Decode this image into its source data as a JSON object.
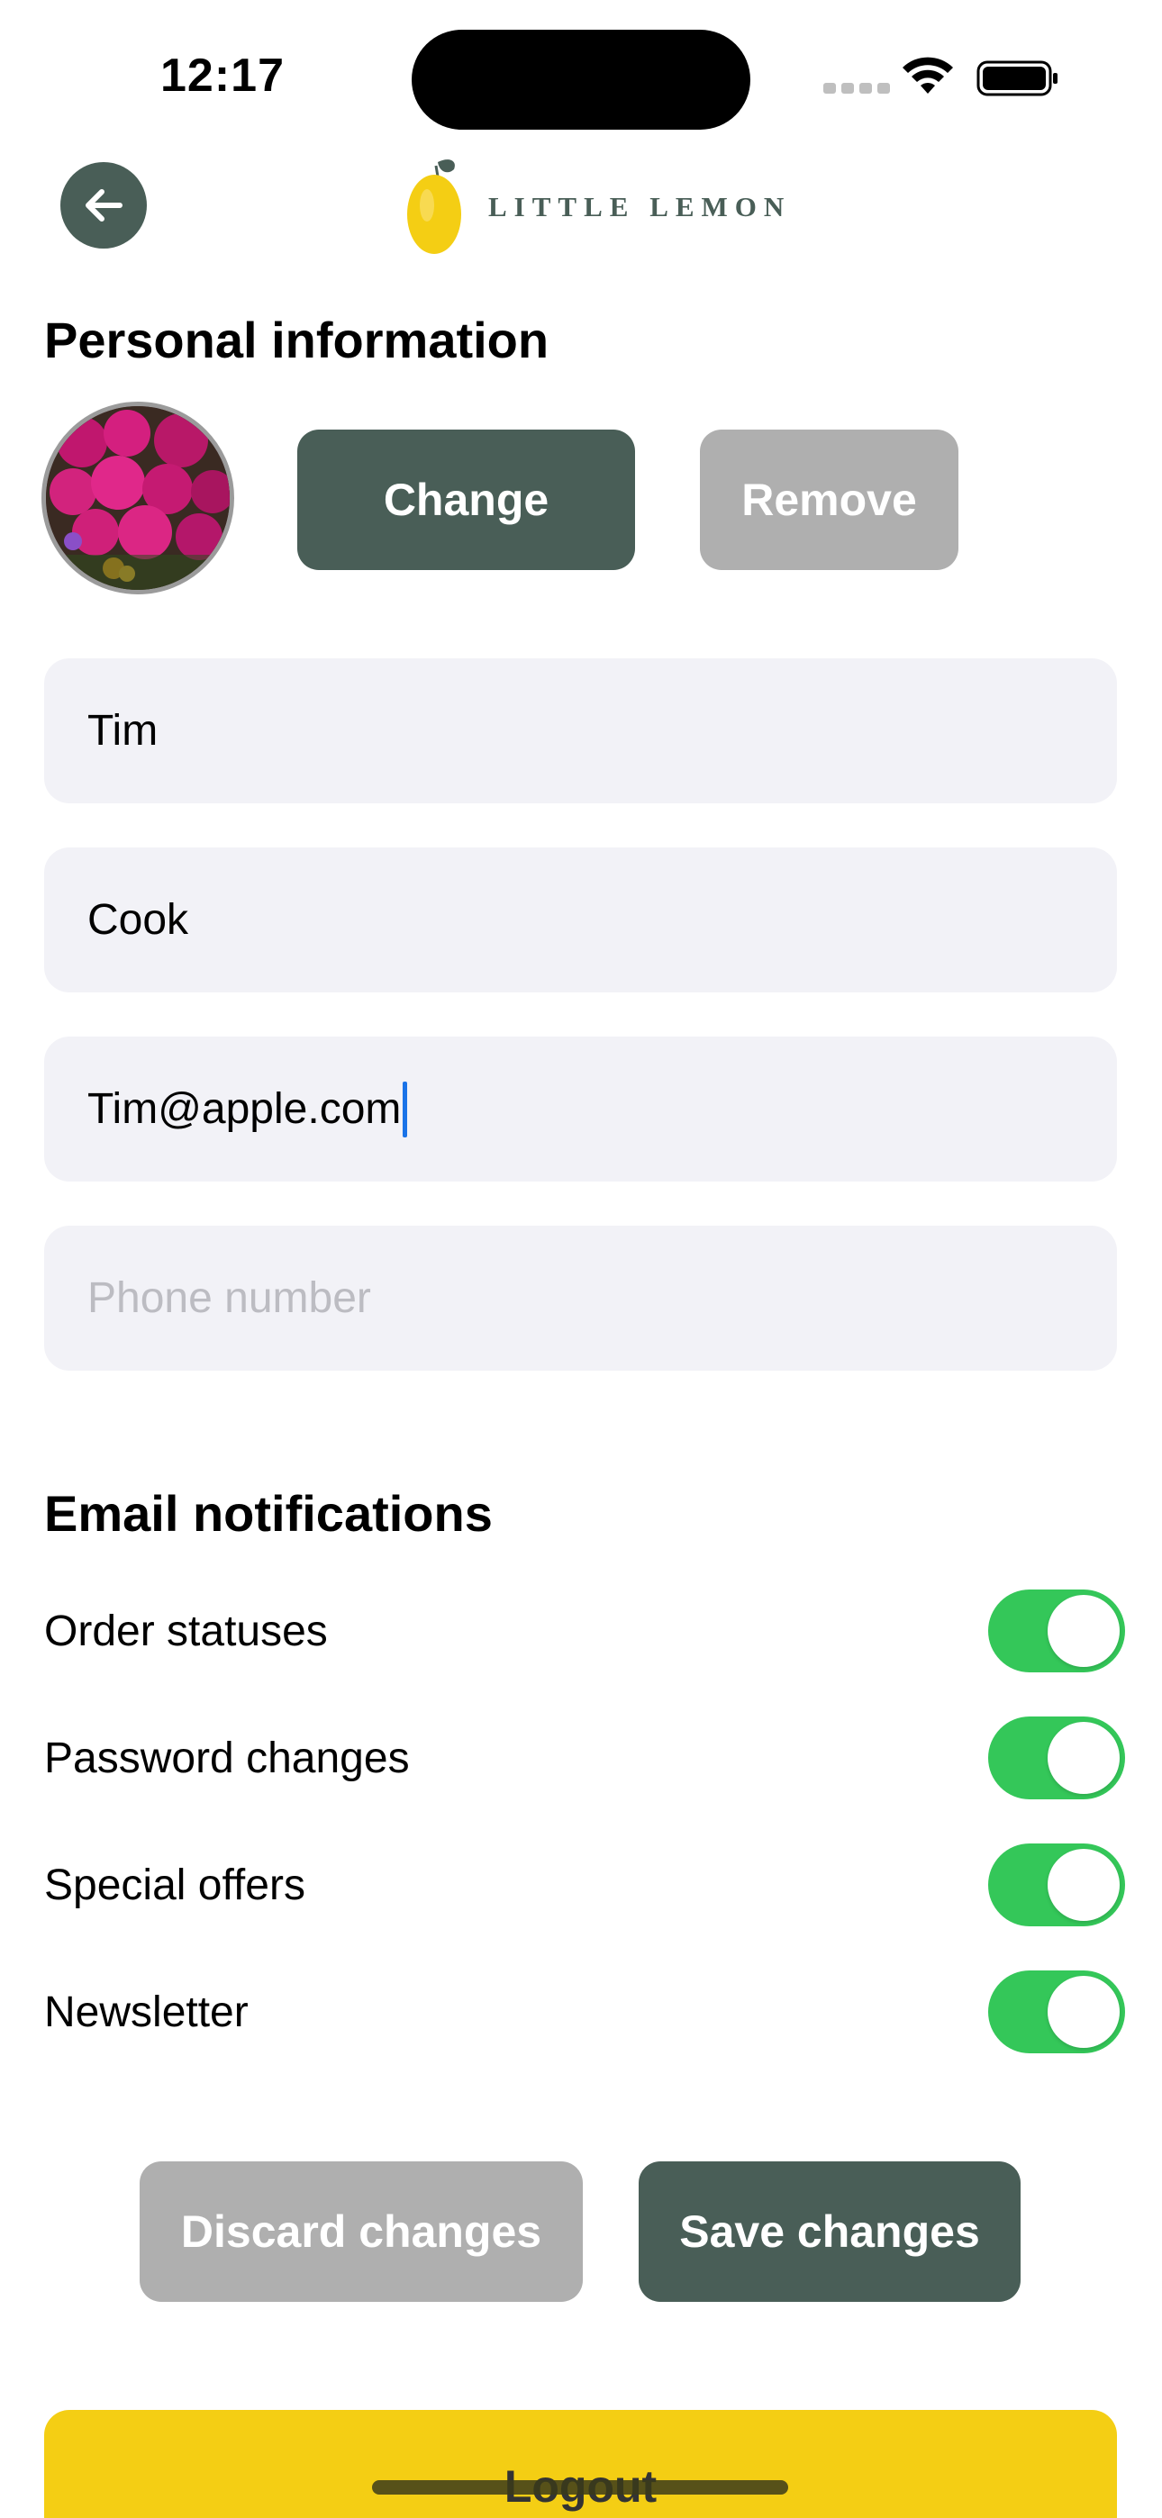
{
  "status_bar": {
    "time": "12:17"
  },
  "header": {
    "logo_text": "LITTLE LEMON",
    "back_icon": "arrow-left-icon"
  },
  "personal_info": {
    "title": "Personal information",
    "change_label": "Change",
    "remove_label": "Remove"
  },
  "form": {
    "first_name": "Tim",
    "last_name": "Cook",
    "email": "Tim@apple.com",
    "phone_placeholder": "Phone number"
  },
  "notifications": {
    "title": "Email notifications",
    "items": [
      {
        "label": "Order statuses",
        "enabled": true
      },
      {
        "label": "Password changes",
        "enabled": true
      },
      {
        "label": "Special offers",
        "enabled": true
      },
      {
        "label": "Newsletter",
        "enabled": true
      }
    ]
  },
  "actions": {
    "discard_label": "Discard changes",
    "save_label": "Save changes",
    "logout_label": "Logout"
  },
  "colors": {
    "primary": "#495e57",
    "secondary_disabled": "#afafaf",
    "accent_yellow": "#f4ce14",
    "toggle_on": "#34c759",
    "field_bg": "#f2f2f7"
  }
}
